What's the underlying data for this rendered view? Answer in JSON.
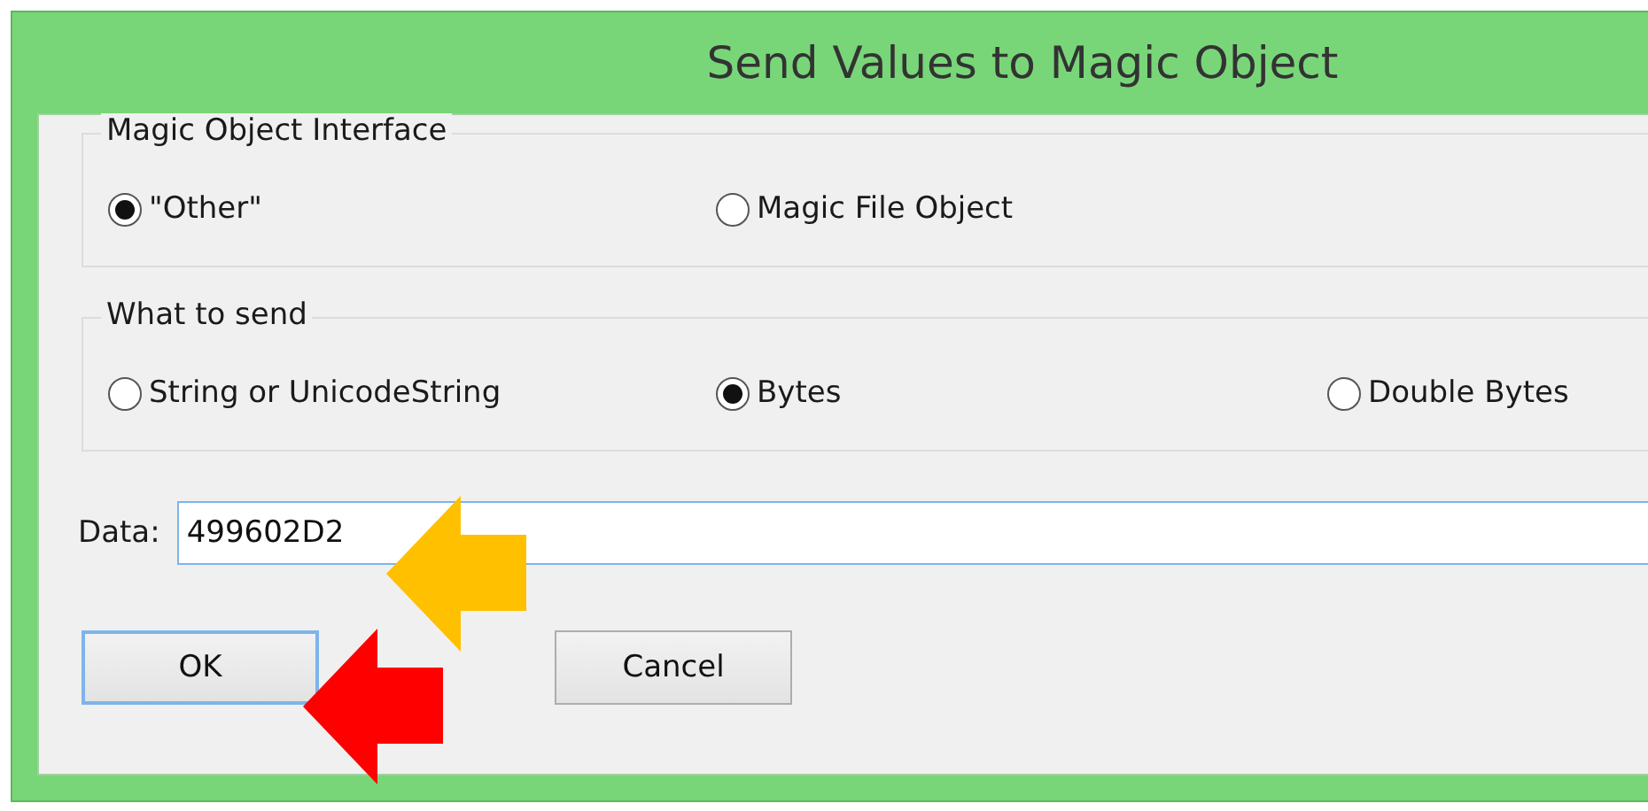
{
  "window": {
    "title": "Send Values to Magic Object"
  },
  "groups": [
    {
      "title": "Magic Object Interface",
      "options": [
        {
          "label": "\"Other\"",
          "selected": true
        },
        {
          "label": "Magic File Object",
          "selected": false
        }
      ]
    },
    {
      "title": "What to send",
      "options": [
        {
          "label": "String or UnicodeString",
          "selected": false
        },
        {
          "label": "Bytes",
          "selected": true
        },
        {
          "label": "Double Bytes",
          "selected": false
        }
      ]
    }
  ],
  "data_field": {
    "label": "Data:",
    "value": "499602D2"
  },
  "buttons": [
    {
      "label": "OK",
      "focused": true
    },
    {
      "label": "Cancel",
      "focused": false
    }
  ],
  "annotations": [
    {
      "kind": "arrow",
      "color": "#ffc000"
    },
    {
      "kind": "arrow",
      "color": "#ff0000"
    }
  ]
}
